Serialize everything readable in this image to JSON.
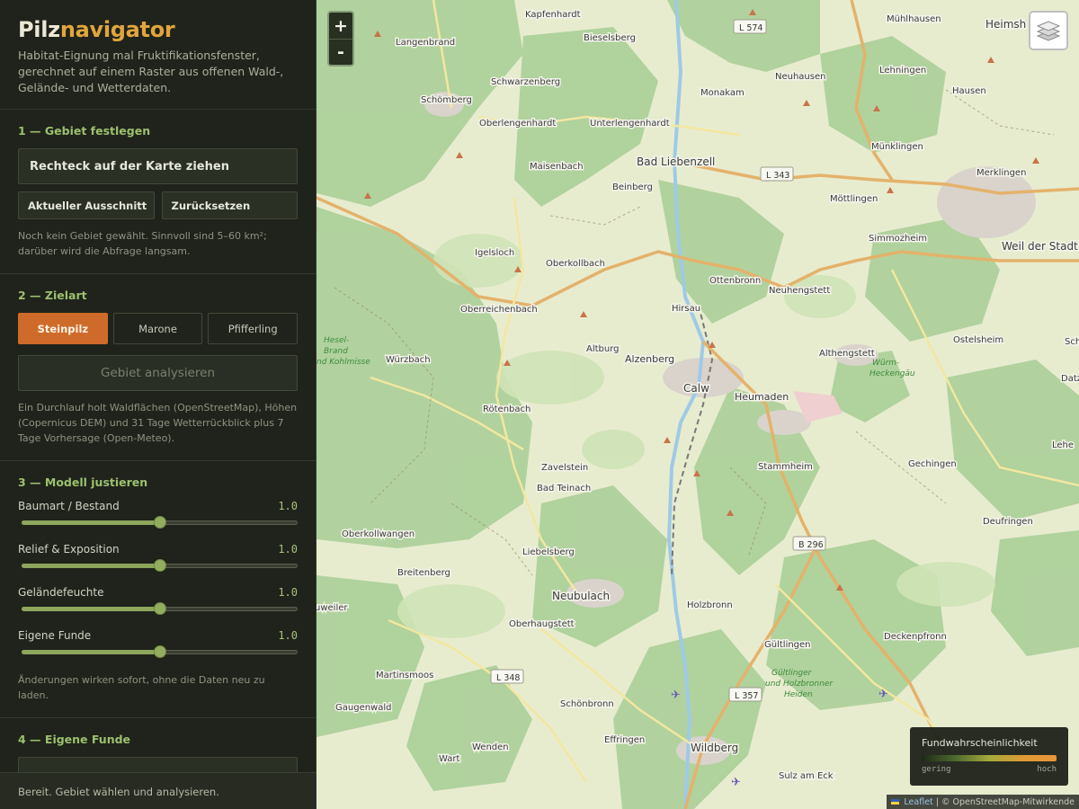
{
  "brand": {
    "part1": "Pilz",
    "part2": "navigator",
    "tagline": "Habitat-Eignung mal Fruktifikationsfenster, gerechnet auf einem Raster aus offenen Wald-, Gelände- und Wetterdaten."
  },
  "area": {
    "title": "1 — Gebiet festlegen",
    "draw_button": "Rechteck auf der Karte ziehen",
    "current_view_button": "Aktueller Ausschnitt",
    "reset_button": "Zurücksetzen",
    "hint": "Noch kein Gebiet gewählt. Sinnvoll sind 5–60 km²; darüber wird die Abfrage langsam."
  },
  "species": {
    "title": "2 — Zielart",
    "options": [
      "Steinpilz",
      "Marone",
      "Pfifferling"
    ],
    "selected": "Steinpilz",
    "analyse_button": "Gebiet analysieren",
    "hint": "Ein Durchlauf holt Waldflächen (OpenStreetMap), Höhen (Copernicus DEM) und 31 Tage Wetterrückblick plus 7 Tage Vorhersage (Open-Meteo)."
  },
  "model": {
    "title": "3 — Modell justieren",
    "sliders": [
      {
        "label": "Baumart / Bestand",
        "value": "1.0",
        "level": 0.5
      },
      {
        "label": "Relief & Exposition",
        "value": "1.0",
        "level": 0.5
      },
      {
        "label": "Geländefeuchte",
        "value": "1.0",
        "level": 0.5
      },
      {
        "label": "Eigene Funde",
        "value": "1.0",
        "level": 0.5
      }
    ],
    "hint": "Änderungen wirken sofort, ohne die Daten neu zu laden."
  },
  "finds": {
    "title": "4 — Eigene Funde"
  },
  "status": "Bereit. Gebiet wählen und analysieren.",
  "map": {
    "zoom_in": "+",
    "zoom_out": "-",
    "layers_icon": "layers-icon",
    "places": [
      "Kapfenhardt",
      "Langenbrand",
      "Bieselsberg",
      "Schwarzenberg",
      "Schömberg",
      "Oberlengenhardt",
      "Unterlengenhardt",
      "Maisenbach",
      "Bad Liebenzell",
      "Beinberg",
      "Monakam",
      "Neuhausen",
      "Mühlhausen",
      "Heimsh",
      "Lehningen",
      "Hausen",
      "Münklingen",
      "Merklingen",
      "Möttlingen",
      "Simmozheim",
      "Weil der Stadt",
      "Igelsloch",
      "Oberkollbach",
      "Ottenbronn",
      "Neuhengstett",
      "Oberreichenbach",
      "Hirsau",
      "Altburg",
      "Alzenberg",
      "Calw",
      "Heumaden",
      "Althengstett",
      "Ostelsheim",
      "Würzbach",
      "Rötenbach",
      "Zavelstein",
      "Bad Teinach",
      "Stammheim",
      "Gechingen",
      "Deufringen",
      "Oberkollwangen",
      "Liebelsberg",
      "Breitenberg",
      "Neubulach",
      "Oberhaugstett",
      "Holzbronn",
      "Gültlingen",
      "Deckenpfronn",
      "Martinsmoos",
      "Gaugenwald",
      "Schönbronn",
      "Effringen",
      "Wildberg",
      "Wenden",
      "Wart",
      "Sulz am Eck",
      "uweiler",
      "Lehe",
      "Datz",
      "Sch"
    ],
    "nature_labels": [
      "Hesel-Brand und Kohlmisse",
      "Würm-Heckengäu",
      "Gültlinger und Holzbronner Heiden"
    ],
    "nature_label_lines": [
      [
        "Hesel-",
        "Brand",
        "nd Kohlmisse"
      ],
      [
        "Würm-",
        "Heckengäu"
      ],
      [
        "Gültlinger",
        "und Holzbronner",
        "Heiden"
      ]
    ],
    "roads": [
      "L 574",
      "L 343",
      "B 296",
      "L 348",
      "L 357"
    ]
  },
  "legend": {
    "title": "Fundwahrscheinlichkeit",
    "low": "gering",
    "high": "hoch"
  },
  "attribution": {
    "leaflet": "Leaflet",
    "separator": "|",
    "osm": "© OpenStreetMap-Mitwirkende"
  },
  "colors": {
    "accent": "#cf6b2a",
    "brand_highlight": "#e1a53c",
    "section_heading": "#9cc06e",
    "forest": "#aed19b",
    "open_land": "#eef0d8"
  }
}
